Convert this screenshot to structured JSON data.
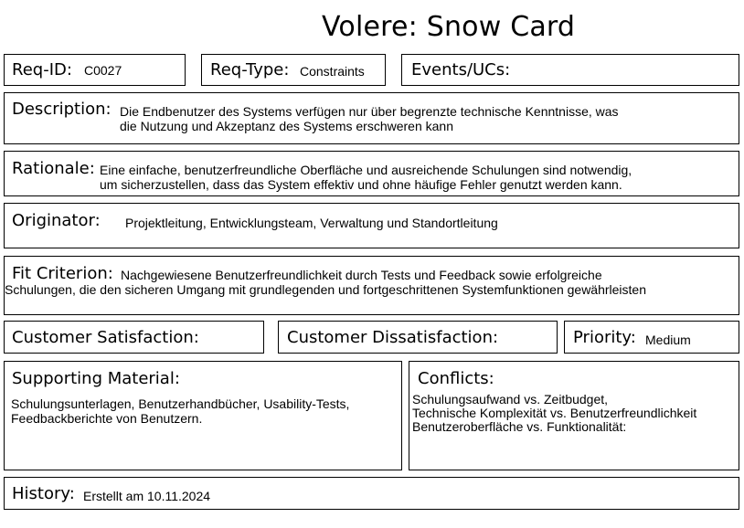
{
  "title": "Volere: Snow Card",
  "req_id": {
    "label": "Req-ID:",
    "value": "C0027"
  },
  "req_type": {
    "label": "Req-Type:",
    "value": "Constraints"
  },
  "events": {
    "label": "Events/UCs:",
    "value": ""
  },
  "description": {
    "label": "Description:",
    "lines": [
      "Die Endbenutzer des Systems verfügen nur über begrenzte technische Kenntnisse, was",
      "die Nutzung und Akzeptanz des Systems erschweren kann"
    ]
  },
  "rationale": {
    "label": "Rationale:",
    "lines": [
      "Eine einfache, benutzerfreundliche Oberfläche und ausreichende Schulungen sind notwendig,",
      "um sicherzustellen, dass das System effektiv und ohne häufige Fehler genutzt werden kann."
    ]
  },
  "originator": {
    "label": "Originator:",
    "value": "Projektleitung, Entwicklungsteam, Verwaltung und Standortleitung"
  },
  "fit_criterion": {
    "label": "Fit Criterion:",
    "line1": "Nachgewiesene Benutzerfreundlichkeit durch Tests und Feedback sowie erfolgreiche",
    "line2": "Schulungen, die den sicheren Umgang mit grundlegenden und fortgeschrittenen Systemfunktionen gewährleisten"
  },
  "customer_satisfaction": {
    "label": "Customer Satisfaction:",
    "value": ""
  },
  "customer_dissatisfaction": {
    "label": "Customer Dissatisfaction:",
    "value": ""
  },
  "priority": {
    "label": "Priority:",
    "value": "Medium"
  },
  "supporting_material": {
    "label": "Supporting Material:",
    "lines": [
      "Schulungsunterlagen, Benutzerhandbücher, Usability-Tests,",
      "Feedbackberichte von Benutzern."
    ]
  },
  "conflicts": {
    "label": "Conflicts:",
    "lines": [
      "Schulungsaufwand vs. Zeitbudget,",
      "Technische Komplexität vs. Benutzerfreundlichkeit",
      "Benutzeroberfläche vs. Funktionalität:"
    ]
  },
  "history": {
    "label": "History:",
    "value": "Erstellt am 10.11.2024"
  }
}
